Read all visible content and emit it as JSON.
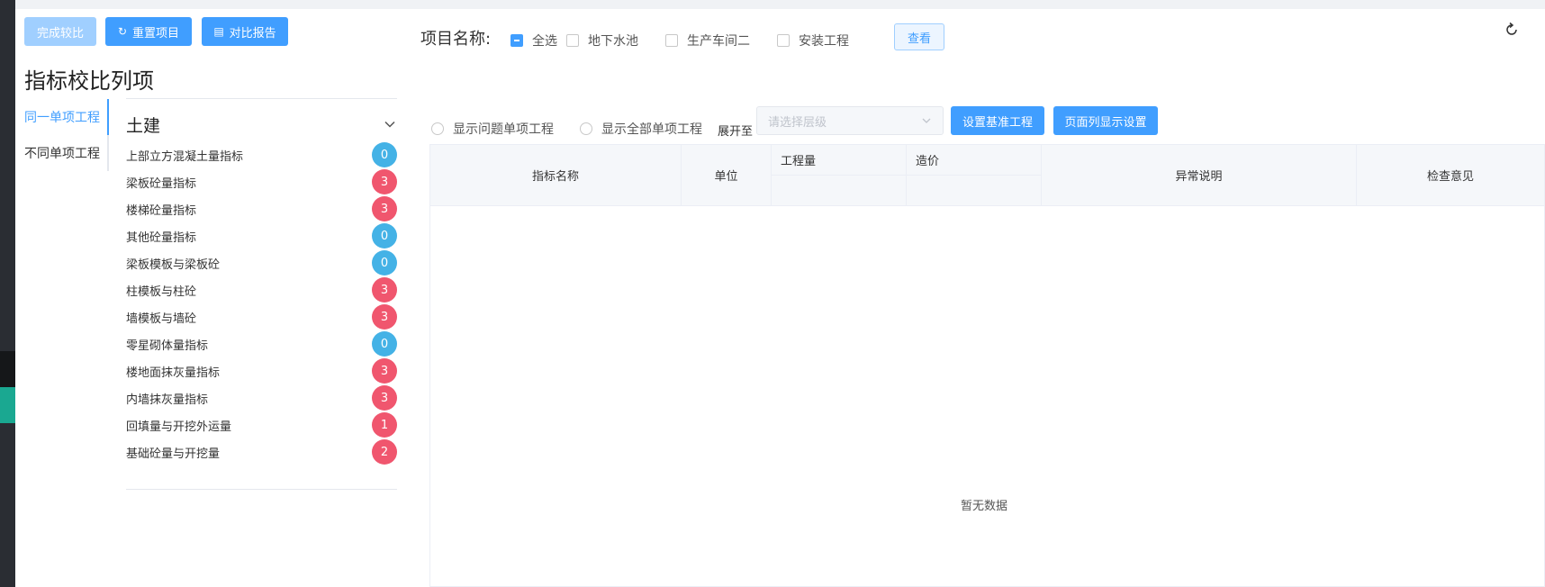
{
  "toolbar": {
    "finish_label": "完成较比",
    "reset_label": "重置项目",
    "report_label": "对比报告"
  },
  "page_title": "指标校比列项",
  "project_filter": {
    "label": "项目名称:",
    "options": [
      {
        "label": "全选",
        "checked": true
      },
      {
        "label": "地下水池",
        "checked": false
      },
      {
        "label": "生产车间二",
        "checked": false
      },
      {
        "label": "安装工程",
        "checked": false
      }
    ],
    "view_label": "查看"
  },
  "side_tabs": [
    {
      "label": "同一单项工程",
      "active": true
    },
    {
      "label": "不同单项工程",
      "active": false
    }
  ],
  "category": {
    "title": "土建",
    "items": [
      {
        "label": "上部立方混凝土量指标",
        "count": "0"
      },
      {
        "label": "梁板砼量指标",
        "count": "3"
      },
      {
        "label": "楼梯砼量指标",
        "count": "3"
      },
      {
        "label": "其他砼量指标",
        "count": "0"
      },
      {
        "label": "梁板模板与梁板砼",
        "count": "0"
      },
      {
        "label": "柱模板与柱砼",
        "count": "3"
      },
      {
        "label": "墙模板与墙砼",
        "count": "3"
      },
      {
        "label": "零星砌体量指标",
        "count": "0"
      },
      {
        "label": "楼地面抹灰量指标",
        "count": "3"
      },
      {
        "label": "内墙抹灰量指标",
        "count": "3"
      },
      {
        "label": "回填量与开挖外运量",
        "count": "1"
      },
      {
        "label": "基础砼量与开挖量",
        "count": "2"
      }
    ]
  },
  "controls": {
    "radio_problem": "显示问题单项工程",
    "radio_all": "显示全部单项工程",
    "expand_label": "展开至",
    "level_placeholder": "请选择层级",
    "set_base_label": "设置基准工程",
    "column_settings_label": "页面列显示设置"
  },
  "table": {
    "headers": {
      "name": "指标名称",
      "unit": "单位",
      "quantity": "工程量",
      "cost": "造价",
      "anomaly": "异常说明",
      "review": "检查意见"
    },
    "empty_text": "暂无数据"
  },
  "colors": {
    "primary": "#409eff",
    "badge_zero": "#44b2e6",
    "badge_warn": "#f0566e"
  }
}
